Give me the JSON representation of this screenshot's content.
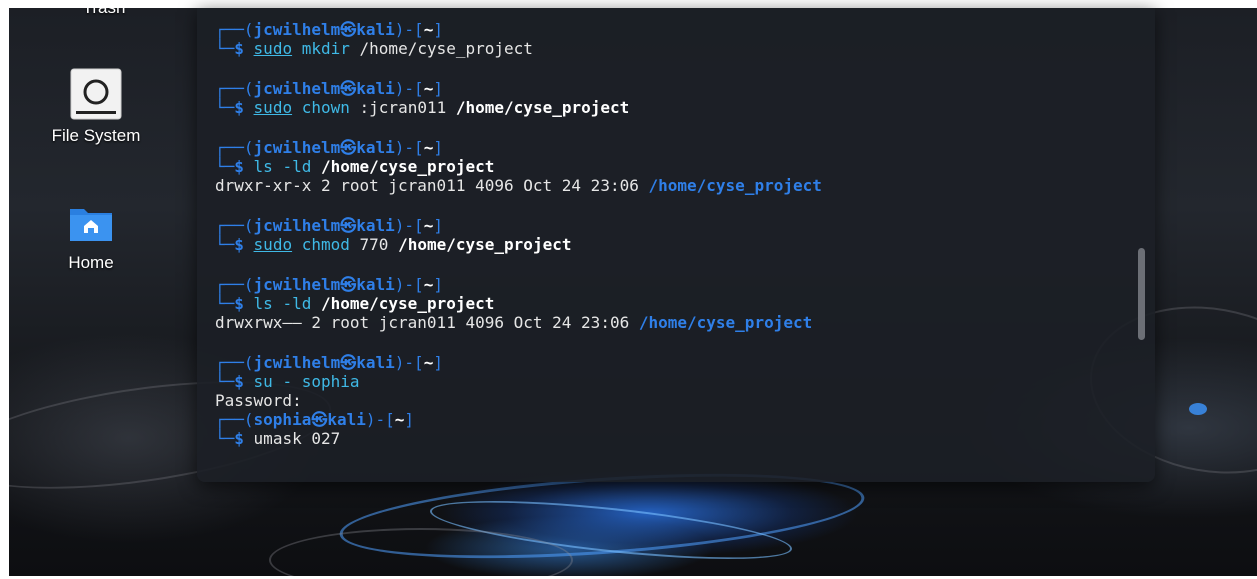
{
  "desktop": {
    "icons": [
      {
        "label": "Trash",
        "icon": "trash-icon"
      },
      {
        "label": "File System",
        "icon": "drive-icon"
      },
      {
        "label": "Home",
        "icon": "home-folder-icon"
      }
    ]
  },
  "terminal": {
    "blocks": [
      {
        "user": "jcwilhelm",
        "host": "kali",
        "dir": "~",
        "sudo": "sudo",
        "cmd": "mkdir",
        "args": "/home/cyse_project",
        "output": ""
      },
      {
        "user": "jcwilhelm",
        "host": "kali",
        "dir": "~",
        "sudo": "sudo",
        "cmd": "chown",
        "args": ":jcran011",
        "path": "/home/cyse_project",
        "output": ""
      },
      {
        "user": "jcwilhelm",
        "host": "kali",
        "dir": "~",
        "cmd": "ls -ld",
        "path": "/home/cyse_project",
        "output_prefix": "drwxr-xr-x 2 root jcran011 4096 Oct 24 23:06 ",
        "output_path": "/home/cyse_project"
      },
      {
        "user": "jcwilhelm",
        "host": "kali",
        "dir": "~",
        "sudo": "sudo",
        "cmd": "chmod",
        "args": "770",
        "path": "/home/cyse_project",
        "output": ""
      },
      {
        "user": "jcwilhelm",
        "host": "kali",
        "dir": "~",
        "cmd": "ls -ld",
        "path": "/home/cyse_project",
        "output_prefix": "drwxrwx—— 2 root jcran011 4096 Oct 24 23:06 ",
        "output_path": "/home/cyse_project"
      },
      {
        "user": "jcwilhelm",
        "host": "kali",
        "dir": "~",
        "cmd": "su - sophia",
        "output": "Password:"
      }
    ],
    "final": {
      "user": "sophia",
      "host": "kali",
      "dir": "~",
      "cmd": "umask 027"
    },
    "prompt_symbol": "$",
    "at_symbol": "㉿"
  }
}
